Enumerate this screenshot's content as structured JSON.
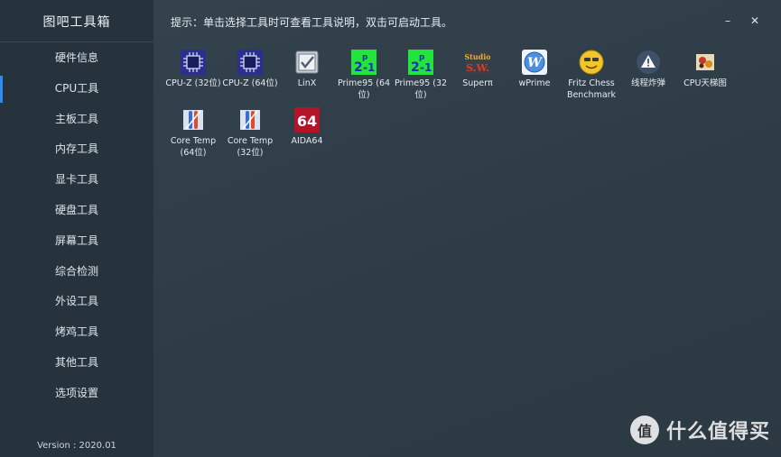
{
  "app": {
    "title": "图吧工具箱",
    "version": "Version : 2020.01"
  },
  "hint": "提示：单击选择工具时可查看工具说明，双击可启动工具。",
  "window": {
    "minimize": "–",
    "close": "✕"
  },
  "sidebar": {
    "active_index": 1,
    "items": [
      {
        "label": "硬件信息"
      },
      {
        "label": "CPU工具"
      },
      {
        "label": "主板工具"
      },
      {
        "label": "内存工具"
      },
      {
        "label": "显卡工具"
      },
      {
        "label": "硬盘工具"
      },
      {
        "label": "屏幕工具"
      },
      {
        "label": "综合检测"
      },
      {
        "label": "外设工具"
      },
      {
        "label": "烤鸡工具"
      },
      {
        "label": "其他工具"
      },
      {
        "label": "选项设置"
      }
    ]
  },
  "tools": [
    {
      "label": "CPU-Z (32位)",
      "icon": "cpu-chip-icon"
    },
    {
      "label": "CPU-Z (64位)",
      "icon": "cpu-chip-icon"
    },
    {
      "label": "LinX",
      "icon": "checkbox-icon"
    },
    {
      "label": "Prime95 (64位)",
      "icon": "prime-formula-icon"
    },
    {
      "label": "Prime95 (32位)",
      "icon": "prime-formula-icon"
    },
    {
      "label": "Superπ",
      "icon": "super-pi-icon",
      "icon_text": "Studio S.W."
    },
    {
      "label": "wPrime",
      "icon": "wprime-icon"
    },
    {
      "label": "Fritz Chess Benchmark",
      "icon": "fritz-face-icon"
    },
    {
      "label": "线程炸弹",
      "icon": "warning-icon"
    },
    {
      "label": "CPU天梯图",
      "icon": "ladder-chart-icon"
    },
    {
      "label": "Core Temp (64位)",
      "icon": "thermometer-icon"
    },
    {
      "label": "Core Temp (32位)",
      "icon": "thermometer-icon"
    },
    {
      "label": "AIDA64",
      "icon": "aida64-icon",
      "icon_text": "64"
    }
  ],
  "watermark": {
    "text": "什么值得买",
    "logo_text": "值"
  },
  "colors": {
    "accent": "#2d8cf0",
    "sidebar_bg": "#26333d",
    "main_bg": "#2f3d48"
  }
}
